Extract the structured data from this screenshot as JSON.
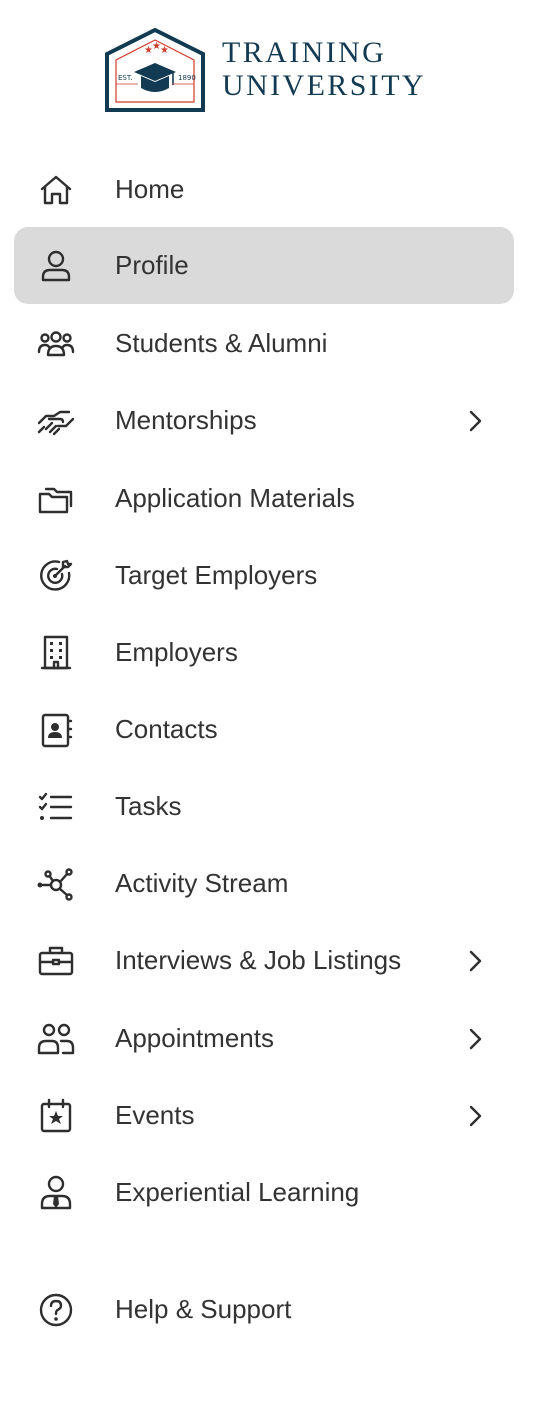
{
  "brand": {
    "line1": "TRAINING",
    "line2": "UNIVERSITY",
    "seal_left": "EST.",
    "seal_right": "1890",
    "colors": {
      "navy": "#123a52",
      "red": "#d23b2a"
    }
  },
  "nav": {
    "active_background": "#dadada",
    "items": [
      {
        "label": "Home",
        "icon": "home-icon",
        "active": false,
        "has_submenu": false
      },
      {
        "label": "Profile",
        "icon": "user-icon",
        "active": true,
        "has_submenu": false
      },
      {
        "label": "Students & Alumni",
        "icon": "users-group-icon",
        "active": false,
        "has_submenu": false
      },
      {
        "label": "Mentorships",
        "icon": "handshake-icon",
        "active": false,
        "has_submenu": true
      },
      {
        "label": "Application Materials",
        "icon": "folders-icon",
        "active": false,
        "has_submenu": false
      },
      {
        "label": "Target Employers",
        "icon": "target-icon",
        "active": false,
        "has_submenu": false
      },
      {
        "label": "Employers",
        "icon": "building-icon",
        "active": false,
        "has_submenu": false
      },
      {
        "label": "Contacts",
        "icon": "contact-book-icon",
        "active": false,
        "has_submenu": false
      },
      {
        "label": "Tasks",
        "icon": "checklist-icon",
        "active": false,
        "has_submenu": false
      },
      {
        "label": "Activity Stream",
        "icon": "network-icon",
        "active": false,
        "has_submenu": false
      },
      {
        "label": "Interviews & Job Listings",
        "icon": "briefcase-icon",
        "active": false,
        "has_submenu": true
      },
      {
        "label": "Appointments",
        "icon": "people-icon",
        "active": false,
        "has_submenu": true
      },
      {
        "label": "Events",
        "icon": "calendar-star-icon",
        "active": false,
        "has_submenu": true
      },
      {
        "label": "Experiential Learning",
        "icon": "person-tie-icon",
        "active": false,
        "has_submenu": false
      },
      {
        "label": "Help & Support",
        "icon": "help-circle-icon",
        "active": false,
        "has_submenu": false
      }
    ]
  }
}
